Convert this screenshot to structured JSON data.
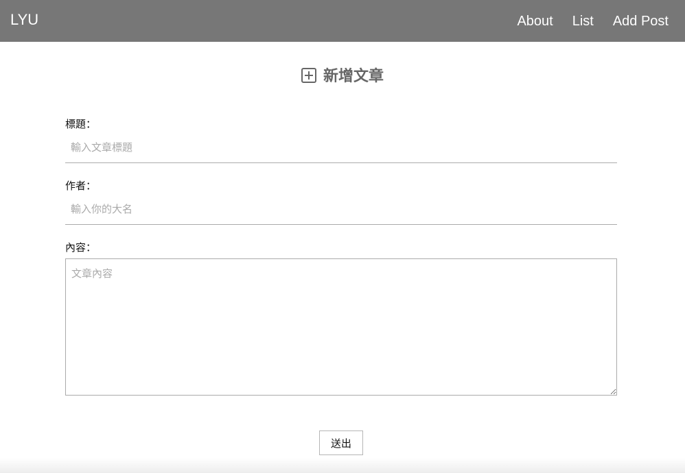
{
  "navbar": {
    "brand": "LYU",
    "links": [
      {
        "label": "About"
      },
      {
        "label": "List"
      },
      {
        "label": "Add Post"
      }
    ]
  },
  "page": {
    "title": "新增文章",
    "title_icon": "plus-square-icon"
  },
  "form": {
    "title_field": {
      "label": "標題：",
      "placeholder": "輸入文章標題",
      "value": ""
    },
    "author_field": {
      "label": "作者：",
      "placeholder": "輸入你的大名",
      "value": ""
    },
    "content_field": {
      "label": "內容：",
      "placeholder": "文章內容",
      "value": ""
    },
    "submit_label": "送出"
  },
  "colors": {
    "navbar_bg": "#777777",
    "title_color": "#666666"
  }
}
